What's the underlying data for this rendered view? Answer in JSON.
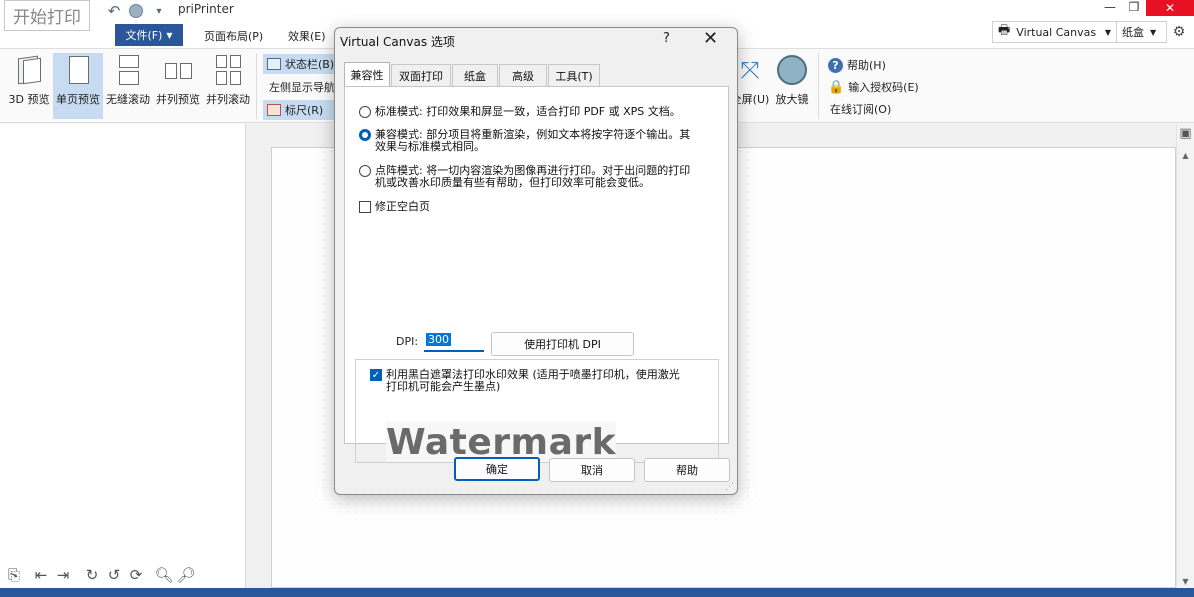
{
  "app": {
    "logo_text": "开始打印",
    "title": "priPrinter",
    "quick_access": [
      "undo-icon",
      "circle-icon",
      "customize-icon"
    ]
  },
  "ribbon_tabs": {
    "file": "文件(F)",
    "layout": "页面布局(P)",
    "effects": "效果(E)"
  },
  "right_tools": {
    "printer": "Virtual Canvas",
    "tray": "纸盒"
  },
  "ribbon": {
    "view_buttons": [
      "3D 预览",
      "单页预览",
      "无缝滚动",
      "并列预览",
      "并列滚动"
    ],
    "status_bar": "状态栏(B)",
    "left_nav": "左侧显示导航",
    "ruler": "标尺(R)",
    "fullscreen": "全屏(U)",
    "magnifier": "放大镜",
    "help": "帮助(H)",
    "license": "输入授权码(E)",
    "order": "在线订阅(O)"
  },
  "dialog": {
    "title": "Virtual Canvas 选项",
    "help_glyph": "?",
    "tabs": [
      "兼容性",
      "双面打印",
      "纸盒",
      "高级",
      "工具(T)"
    ],
    "selected_tab": "兼容性",
    "options": {
      "standard": "标准模式: 打印效果和屏显一致，适合打印 PDF 或 XPS 文档。",
      "compat_line1": "兼容模式: 部分项目将重新渲染，例如文本将按字符逐个输出。其",
      "compat_line2": "效果与标准模式相同。",
      "raster_line1": "点阵模式: 将一切内容渲染为图像再进行打印。对于出问题的打印",
      "raster_line2": "机或改善水印质量有些有帮助，但打印效率可能会变低。",
      "fix_blank": "修正空白页"
    },
    "selected_mode": "compat",
    "dpi_label": "DPI:",
    "dpi_value": "300",
    "use_printer_dpi": "使用打印机 DPI",
    "watermark_line1": "利用黑白遮罩法打印水印效果 (适用于喷墨打印机，使用激光",
    "watermark_line2": "打印机可能会产生墨点)",
    "watermark_checked": true,
    "watermark_preview": "Watermark",
    "ok": "确定",
    "cancel": "取消",
    "help": "帮助"
  },
  "colors": {
    "accent": "#2b579a",
    "selection": "#005fb8"
  }
}
